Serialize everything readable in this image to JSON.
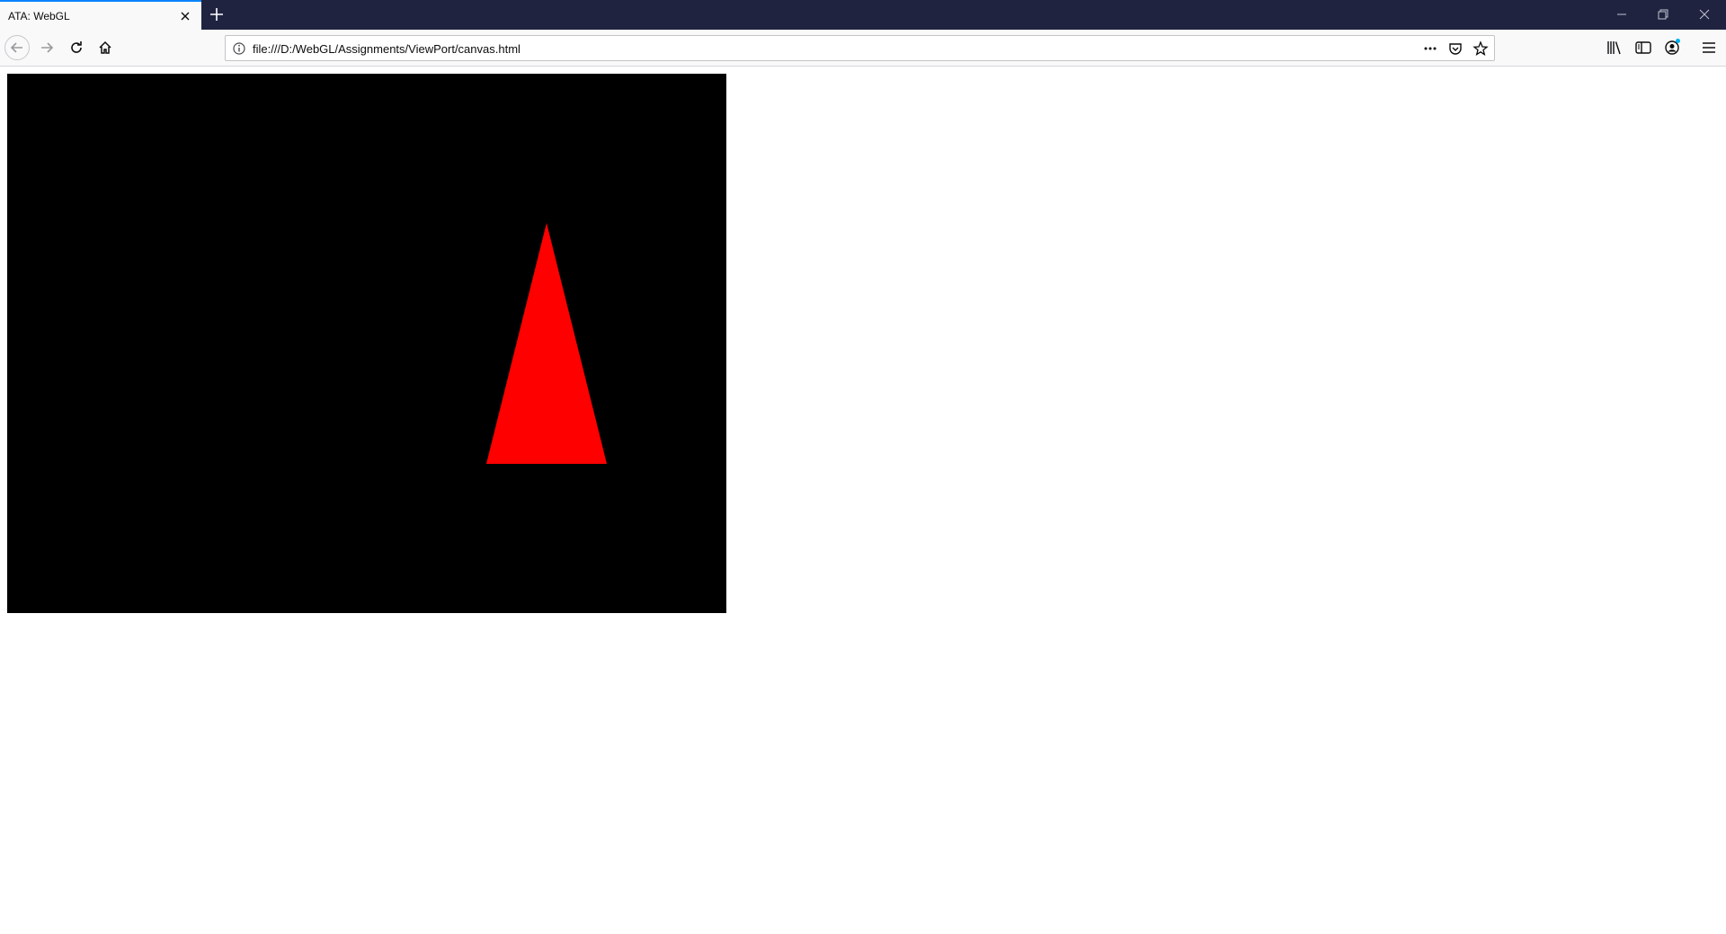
{
  "browser": {
    "tab": {
      "title": "ATA: WebGL"
    },
    "address_bar": {
      "url": "file:///D:/WebGL/Assignments/ViewPort/canvas.html"
    },
    "icons": {
      "tab_close": "close-icon",
      "new_tab": "plus-icon",
      "minimize": "minimize-icon",
      "restore": "restore-icon",
      "close_window": "close-icon",
      "back": "arrow-left-icon",
      "forward": "arrow-right-icon",
      "reload": "reload-icon",
      "home": "home-icon",
      "page_info": "info-icon",
      "page_actions": "ellipsis-icon",
      "pocket": "pocket-icon",
      "bookmark": "star-icon",
      "library": "library-icon",
      "sidebar": "sidebar-icon",
      "account": "account-icon",
      "menu": "hamburger-menu-icon"
    },
    "colors": {
      "accent": "#0a84ff",
      "tabstrip": "#202340"
    }
  },
  "page": {
    "canvas": {
      "background": "#000000",
      "shape": "triangle",
      "shape_color": "#ff0000"
    }
  }
}
